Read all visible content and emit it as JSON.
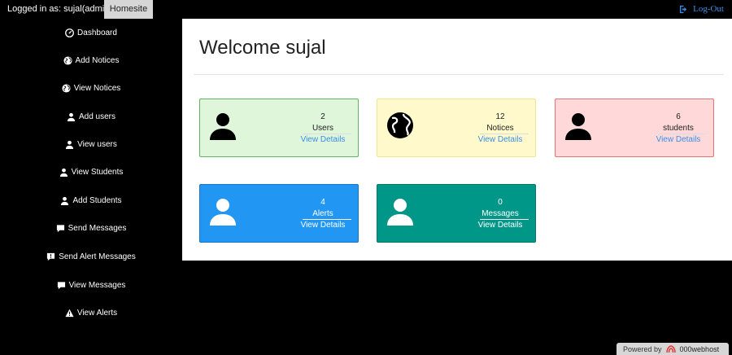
{
  "topbar": {
    "logged_in": "Logged in as: sujal(admin)",
    "homesite": "Homesite",
    "logout": "Log-Out"
  },
  "sidebar": {
    "items": [
      {
        "label": "Dashboard",
        "icon": "dashboard-icon"
      },
      {
        "label": "Add Notices",
        "icon": "globe-icon"
      },
      {
        "label": "View Notices",
        "icon": "globe-icon"
      },
      {
        "label": "Add users",
        "icon": "user-icon"
      },
      {
        "label": "View users",
        "icon": "user-icon"
      },
      {
        "label": "View Students",
        "icon": "user-icon"
      },
      {
        "label": "Add Students",
        "icon": "user-icon"
      },
      {
        "label": "Send Messages",
        "icon": "comment-icon"
      },
      {
        "label": "Send Alert Messages",
        "icon": "alert-comment-icon"
      },
      {
        "label": "View Messages",
        "icon": "comment-icon"
      },
      {
        "label": "View Alerts",
        "icon": "warning-icon"
      }
    ]
  },
  "main": {
    "welcome": "Welcome sujal",
    "cards": [
      {
        "count": "2",
        "label": "Users",
        "link": "View Details",
        "icon": "user-icon"
      },
      {
        "count": "12",
        "label": "Notices",
        "link": "View Details",
        "icon": "globe-icon"
      },
      {
        "count": "6",
        "label": "students",
        "link": "View Details",
        "icon": "user-icon"
      },
      {
        "count": "4",
        "label": "Alerts",
        "link": "View Details",
        "icon": "user-icon"
      },
      {
        "count": "0",
        "label": "Messages",
        "link": "View Details",
        "icon": "user-icon"
      }
    ]
  },
  "footer": {
    "powered_by": "Powered by",
    "brand": "000webhost"
  },
  "colors": {
    "users_bg": "#dff6da",
    "notices_bg": "#fff9cc",
    "students_bg": "#ffd9d9",
    "alerts_bg": "#2196f3",
    "messages_bg": "#009688",
    "link": "#3a8ee6"
  }
}
